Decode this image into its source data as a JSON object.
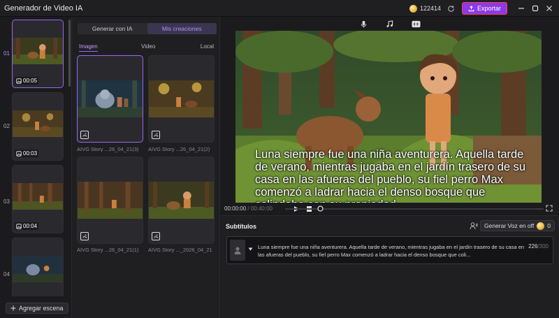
{
  "app": {
    "title": "Generador de Video IA"
  },
  "header": {
    "credits": "122414",
    "export_label": "Exportar"
  },
  "scenes": {
    "items": [
      {
        "num": "01",
        "duration": "00:05",
        "active": true
      },
      {
        "num": "02",
        "duration": "00:03",
        "active": false
      },
      {
        "num": "03",
        "duration": "00:04",
        "active": false
      },
      {
        "num": "04",
        "duration": "",
        "active": false
      }
    ],
    "add_label": "Agregar escena"
  },
  "media": {
    "tabs": [
      "Generar con IA",
      "Mis creaciones"
    ],
    "subtabs": [
      "Imagen",
      "Video",
      "Local"
    ],
    "items": [
      {
        "label": "AIVG Story ...26_04_21(3)"
      },
      {
        "label": "AIVG Story ...26_04_21(2)"
      },
      {
        "label": "AIVG Story ...26_04_21(1)"
      },
      {
        "label": "AIVG Story ..._2026_04_21"
      }
    ]
  },
  "preview": {
    "caption": "Luna siempre fue una niña aventurera. Aquella tarde de verano, mientras jugaba en el jardín trasero de su casa en las afueras del pueblo, su fiel perro Max comenzó a ladrar hacia el denso bosque que colindaba con su propiedad",
    "current_time": "00:00:00",
    "total_time": "00:40:00"
  },
  "subtitles": {
    "title": "Subtítulos",
    "voice_label": "Generar Voz en off",
    "voice_cost": "0",
    "text": "Luna siempre fue una niña aventurera. Aquella tarde de verano, mientras jugaba en el jardín trasero de su casa en las afueras del pueblo, su fiel perro Max comenzó a ladrar hacia el denso bosque que coli...",
    "count": "226",
    "max": "/300"
  }
}
